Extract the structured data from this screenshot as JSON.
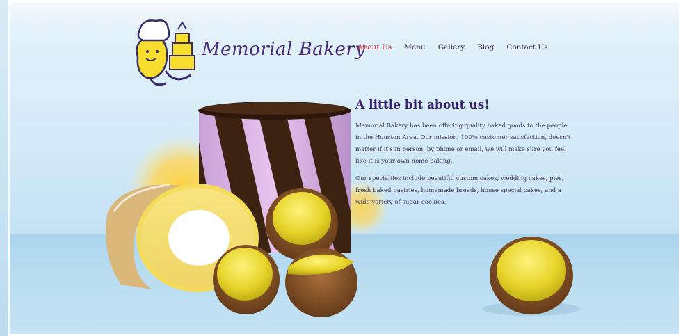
{
  "brand": {
    "name": "Memorial Bakery"
  },
  "nav": {
    "items": [
      {
        "label": "About Us",
        "active": true
      },
      {
        "label": "Menu",
        "active": false
      },
      {
        "label": "Gallery",
        "active": false
      },
      {
        "label": "Blog",
        "active": false
      },
      {
        "label": "Contact Us",
        "active": false
      }
    ]
  },
  "about": {
    "heading": "A little bit about us!",
    "paragraph_1": "Memorial Bakery has been offering quality baked goods to the people in the Houston Area. Our mission, 100% customer satisfaction, doesn't matter if it's in person, by phone or email, we will make sure you feel like it is your own home baking.",
    "paragraph_2": "Our specialties include beautiful custom cakes, wedding cakes, pies, fresh baked pastries, homemade breads, house special cakes, and a wide variety of sugar cookies."
  },
  "colors": {
    "accent_active": "#d8282f",
    "heading": "#3a2170",
    "body_text": "#3e3358",
    "sky": "#d7ecf8"
  },
  "icons": {
    "logo_mascot": "baker-mascot-icon"
  }
}
